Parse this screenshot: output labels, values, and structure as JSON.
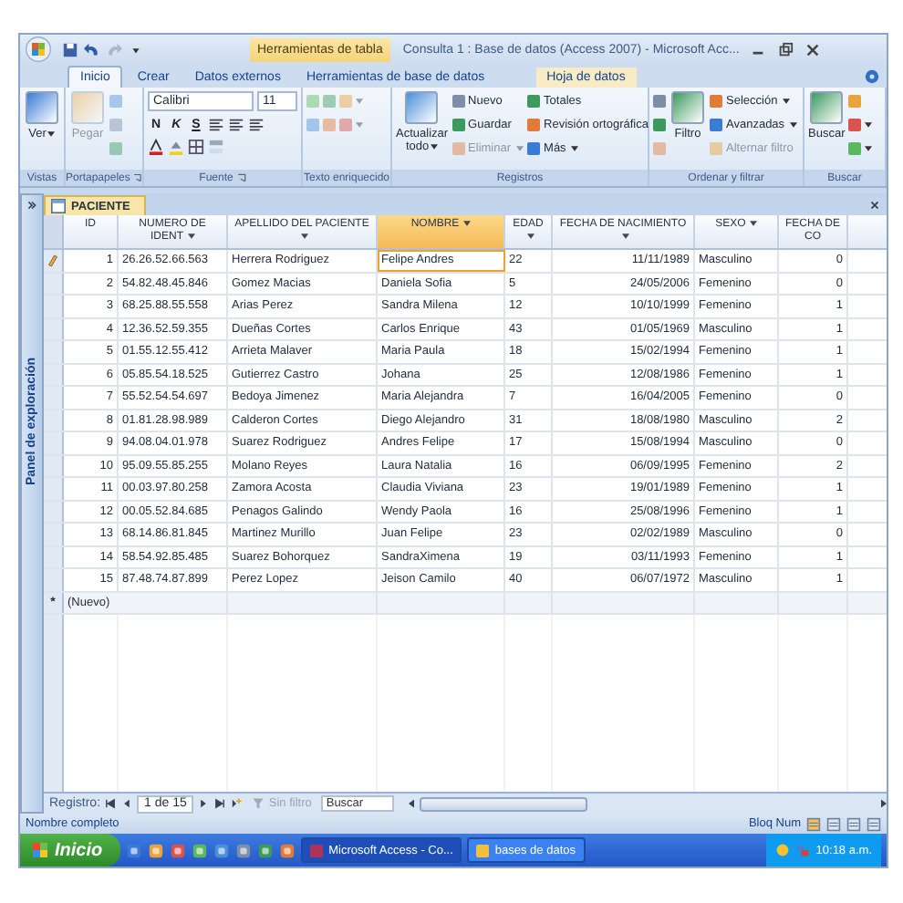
{
  "window": {
    "title": "Consulta 1 : Base de datos (Access 2007) - Microsoft Acc...",
    "context_tab": "Herramientas de tabla"
  },
  "ribbon_tabs": [
    {
      "label": "Inicio",
      "selected": true
    },
    {
      "label": "Crear",
      "selected": false
    },
    {
      "label": "Datos externos",
      "selected": false
    },
    {
      "label": "Herramientas de base de datos",
      "selected": false
    },
    {
      "label": "Hoja de datos",
      "selected": false
    }
  ],
  "ribbon_groups": [
    {
      "label": "Vistas",
      "kind": "commands",
      "launcher": false,
      "columns": [
        [
          {
            "kind": "large",
            "label": "Ver",
            "disabled": false,
            "dropdown": true
          }
        ]
      ]
    },
    {
      "label": "Portapapeles",
      "kind": "commands",
      "launcher": true,
      "columns": [
        [
          {
            "kind": "large",
            "label": "Pegar",
            "disabled": true,
            "dropdown": false
          }
        ],
        [
          {
            "kind": "icon",
            "disabled": true,
            "dropdown": false
          },
          {
            "kind": "icon",
            "disabled": true,
            "dropdown": false
          },
          {
            "kind": "icon",
            "disabled": true,
            "dropdown": false
          }
        ]
      ]
    },
    {
      "label": "Fuente",
      "kind": "font",
      "launcher": true,
      "font": "Calibri",
      "size": "11",
      "styles": [
        "N",
        "K",
        "S"
      ]
    },
    {
      "label": "Texto enriquecido",
      "kind": "commands",
      "launcher": false,
      "columns": [
        [
          {
            "kind": "icon",
            "disabled": true,
            "dropdown": false
          },
          {
            "kind": "icon",
            "disabled": true,
            "dropdown": false
          }
        ],
        [
          {
            "kind": "icon",
            "disabled": true,
            "dropdown": false
          },
          {
            "kind": "icon",
            "disabled": true,
            "dropdown": false
          }
        ],
        [
          {
            "kind": "icon",
            "disabled": true,
            "dropdown": true
          },
          {
            "kind": "icon",
            "disabled": true,
            "dropdown": true
          }
        ]
      ]
    },
    {
      "label": "Registros",
      "kind": "commands",
      "launcher": false,
      "columns": [
        [
          {
            "kind": "large",
            "label": "Actualizar todo",
            "disabled": false,
            "dropdown": true
          }
        ],
        [
          {
            "kind": "small",
            "label": "Nuevo",
            "disabled": false,
            "dropdown": false
          },
          {
            "kind": "small",
            "label": "Guardar",
            "disabled": false,
            "dropdown": false
          },
          {
            "kind": "small",
            "label": "Eliminar",
            "disabled": true,
            "dropdown": true
          }
        ],
        [
          {
            "kind": "small",
            "label": "Totales",
            "disabled": false,
            "dropdown": false
          },
          {
            "kind": "small",
            "label": "Revisión ortográfica",
            "disabled": false,
            "dropdown": false
          },
          {
            "kind": "small",
            "label": "Más",
            "disabled": false,
            "dropdown": true
          }
        ]
      ]
    },
    {
      "label": "Ordenar y filtrar",
      "kind": "commands",
      "launcher": false,
      "columns": [
        [
          {
            "kind": "icon",
            "disabled": false,
            "dropdown": false
          },
          {
            "kind": "icon",
            "disabled": false,
            "dropdown": false
          },
          {
            "kind": "icon",
            "disabled": true,
            "dropdown": false
          }
        ],
        [
          {
            "kind": "large",
            "label": "Filtro",
            "disabled": false,
            "dropdown": false
          }
        ],
        [
          {
            "kind": "small",
            "label": "Selección",
            "disabled": false,
            "dropdown": true
          },
          {
            "kind": "small",
            "label": "Avanzadas",
            "disabled": false,
            "dropdown": true
          },
          {
            "kind": "small",
            "label": "Alternar filtro",
            "disabled": true,
            "dropdown": false
          }
        ]
      ]
    },
    {
      "label": "Buscar",
      "kind": "commands",
      "launcher": false,
      "columns": [
        [
          {
            "kind": "large",
            "label": "Buscar",
            "disabled": false,
            "dropdown": false
          }
        ],
        [
          {
            "kind": "icon",
            "disabled": false,
            "dropdown": false
          },
          {
            "kind": "icon",
            "disabled": false,
            "dropdown": true
          },
          {
            "kind": "icon",
            "disabled": false,
            "dropdown": true
          }
        ]
      ]
    }
  ],
  "nav_pane": {
    "label": "Panel de exploración"
  },
  "document_tab": {
    "label": "PACIENTE"
  },
  "table": {
    "columns": [
      {
        "label": "ID",
        "selected": false
      },
      {
        "label": "NUMERO DE IDENT",
        "selected": false
      },
      {
        "label": "APELLIDO DEL PACIENTE",
        "selected": false
      },
      {
        "label": "NOMBRE",
        "selected": true
      },
      {
        "label": "EDAD",
        "selected": false
      },
      {
        "label": "FECHA DE NACIMIENTO",
        "selected": false
      },
      {
        "label": "SEXO",
        "selected": false
      },
      {
        "label": "FECHA DE CO",
        "selected": false
      }
    ],
    "rows": [
      {
        "editing": true,
        "cells": [
          "1",
          "26.26.52.66.563",
          "Herrera Rodriguez",
          "Felipe Andres",
          "22",
          "11/11/1989",
          "Masculino",
          "0"
        ]
      },
      {
        "editing": false,
        "cells": [
          "2",
          "54.82.48.45.846",
          "Gomez Macias",
          "Daniela Sofia",
          "5",
          "24/05/2006",
          "Femenino",
          "0"
        ]
      },
      {
        "editing": false,
        "cells": [
          "3",
          "68.25.88.55.558",
          "Arias Perez",
          "Sandra Milena",
          "12",
          "10/10/1999",
          "Femenino",
          "1"
        ]
      },
      {
        "editing": false,
        "cells": [
          "4",
          "12.36.52.59.355",
          "Dueñas Cortes",
          "Carlos Enrique",
          "43",
          "01/05/1969",
          "Masculino",
          "1"
        ]
      },
      {
        "editing": false,
        "cells": [
          "5",
          "01.55.12.55.412",
          "Arrieta Malaver",
          "Maria Paula",
          "18",
          "15/02/1994",
          "Femenino",
          "1"
        ]
      },
      {
        "editing": false,
        "cells": [
          "6",
          "05.85.54.18.525",
          "Gutierrez Castro",
          "Johana",
          "25",
          "12/08/1986",
          "Femenino",
          "1"
        ]
      },
      {
        "editing": false,
        "cells": [
          "7",
          "55.52.54.54.697",
          "Bedoya Jimenez",
          "Maria Alejandra",
          "7",
          "16/04/2005",
          "Femenino",
          "0"
        ]
      },
      {
        "editing": false,
        "cells": [
          "8",
          "01.81.28.98.989",
          "Calderon Cortes",
          "Diego Alejandro",
          "31",
          "18/08/1980",
          "Masculino",
          "2"
        ]
      },
      {
        "editing": false,
        "cells": [
          "9",
          "94.08.04.01.978",
          "Suarez Rodriguez",
          "Andres Felipe",
          "17",
          "15/08/1994",
          "Masculino",
          "0"
        ]
      },
      {
        "editing": false,
        "cells": [
          "10",
          "95.09.55.85.255",
          "Molano Reyes",
          "Laura Natalia",
          "16",
          "06/09/1995",
          "Femenino",
          "2"
        ]
      },
      {
        "editing": false,
        "cells": [
          "11",
          "00.03.97.80.258",
          "Zamora Acosta",
          "Claudia Viviana",
          "23",
          "19/01/1989",
          "Femenino",
          "1"
        ]
      },
      {
        "editing": false,
        "cells": [
          "12",
          "00.05.52.84.685",
          "Penagos Galindo",
          "Wendy Paola",
          "16",
          "25/08/1996",
          "Femenino",
          "1"
        ]
      },
      {
        "editing": false,
        "cells": [
          "13",
          "68.14.86.81.845",
          "Martinez Murillo",
          "Juan Felipe",
          "23",
          "02/02/1989",
          "Masculino",
          "0"
        ]
      },
      {
        "editing": false,
        "cells": [
          "14",
          "58.54.92.85.485",
          "Suarez Bohorquez",
          "SandraXimena",
          "19",
          "03/11/1993",
          "Femenino",
          "1"
        ]
      },
      {
        "editing": false,
        "cells": [
          "15",
          "87.48.74.87.899",
          "Perez Lopez",
          "Jeison Camilo",
          "40",
          "06/07/1972",
          "Masculino",
          "1"
        ]
      }
    ],
    "new_row": {
      "marker": "*",
      "label": "(Nuevo)"
    }
  },
  "record_nav": {
    "label": "Registro:",
    "position": "1 de 15",
    "filter": "Sin filtro",
    "search_placeholder": "Buscar"
  },
  "status_bar": {
    "left": "Nombre completo",
    "right": "Bloq Num"
  },
  "taskbar": {
    "start": "Inicio",
    "tasks": [
      {
        "label": "Microsoft Access - Co...",
        "selected": true
      },
      {
        "label": "bases de datos",
        "selected": false
      }
    ],
    "clock": "10:18 a.m."
  }
}
